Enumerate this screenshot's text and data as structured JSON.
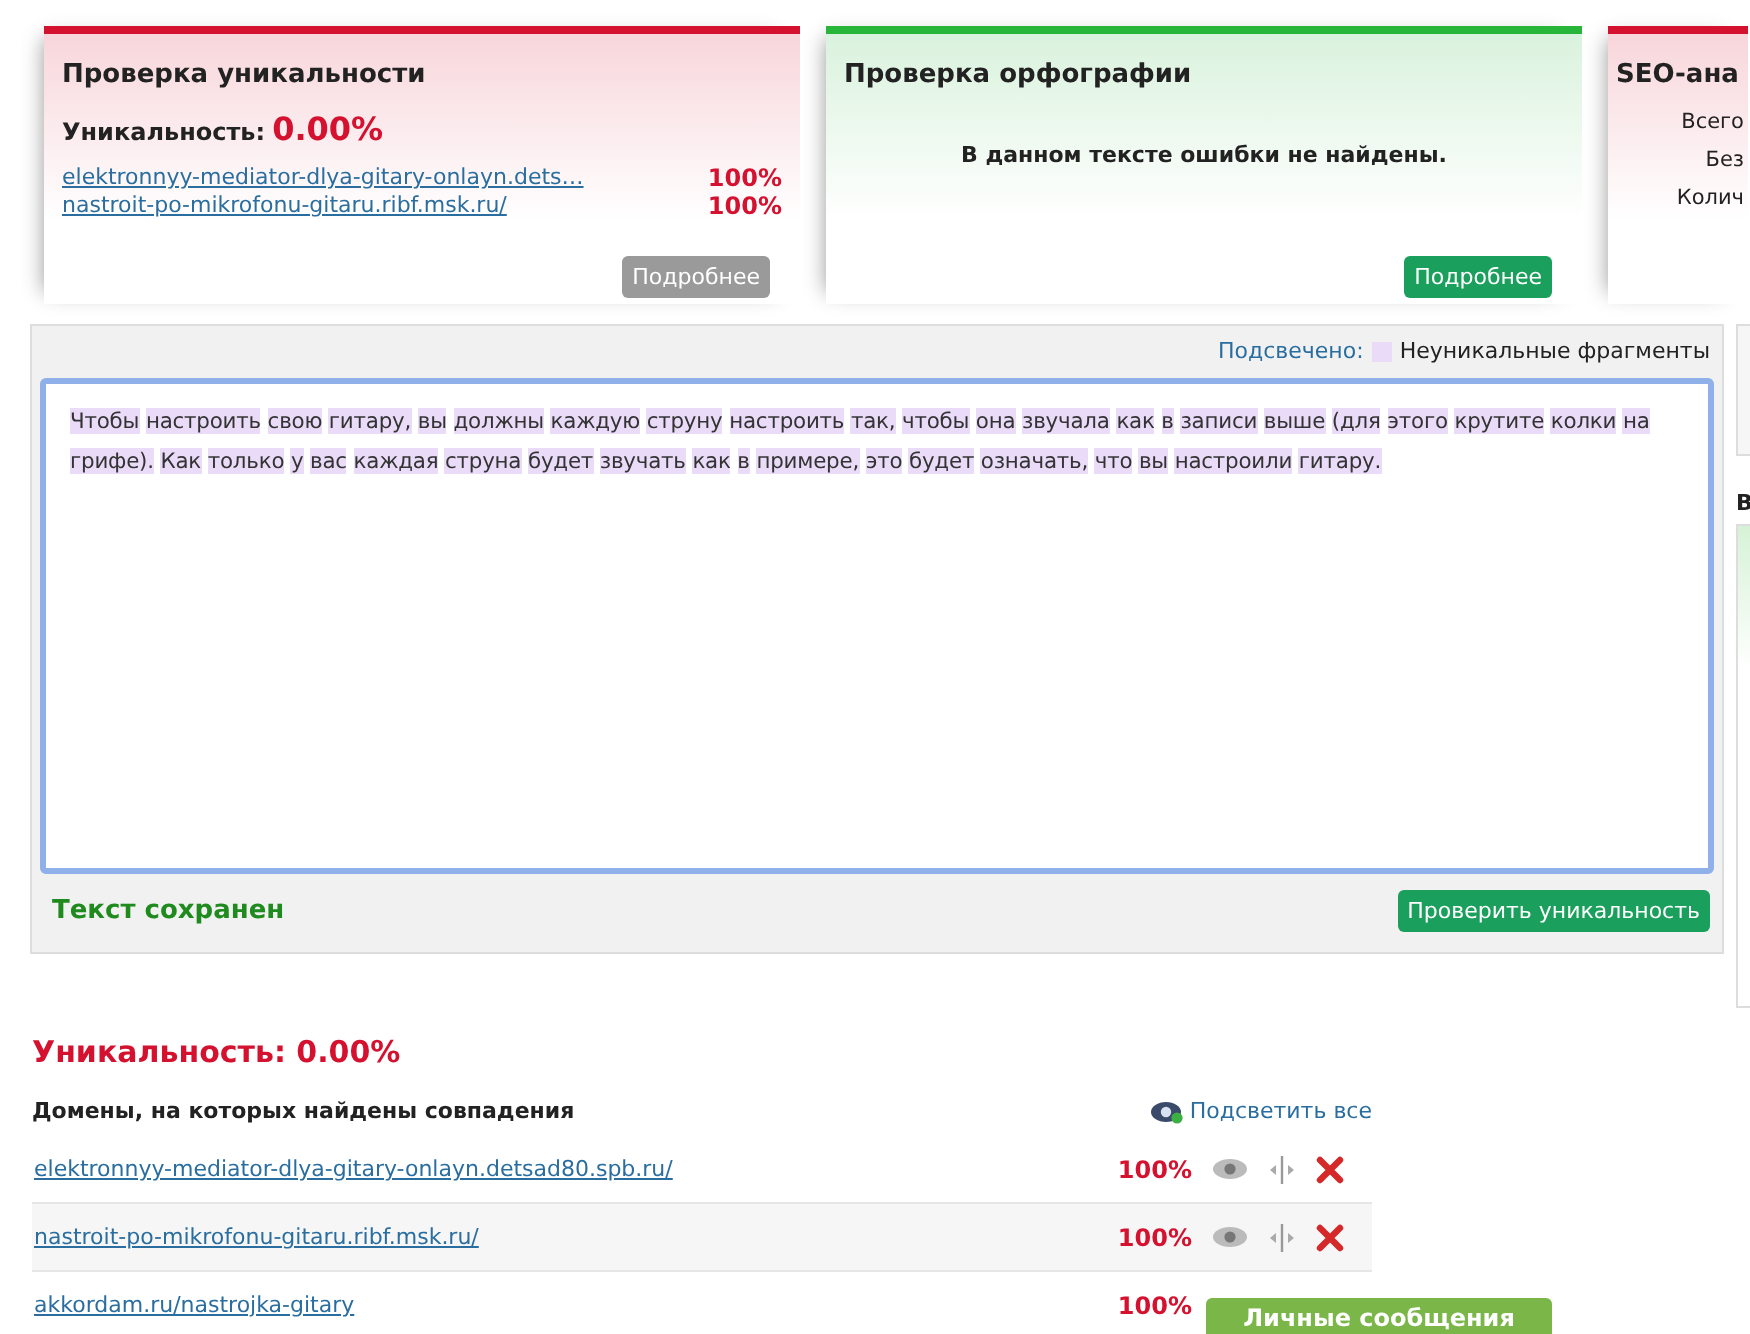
{
  "cards": [
    {
      "kind": "uniqueness",
      "color": "#d4112e",
      "title": "Проверка уникальности",
      "label": "Уникальность:",
      "value": "0.00%",
      "links": [
        {
          "url": "elektronnyy-mediator-dlya-gitary-onlayn.dets…",
          "percent": "100%"
        },
        {
          "url": "nastroit-po-mikrofonu-gitaru.ribf.msk.ru/",
          "percent": "100%"
        }
      ],
      "button": "Подробнее",
      "button_disabled": true
    },
    {
      "kind": "spelling",
      "color": "#27b53a",
      "title": "Проверка орфографии",
      "message": "В данном тексте ошибки не найдены.",
      "button": "Подробнее",
      "button_disabled": false
    },
    {
      "kind": "seo",
      "color": "#d4112e",
      "title": "SEO-ана",
      "lines": [
        "Всего",
        "Без",
        "Колич"
      ]
    }
  ],
  "editor": {
    "legend_label": "Подсвечено:",
    "legend_text": "Неуникальные фрагменты",
    "text": "Чтобы настроить свою гитару, вы должны каждую струну настроить так, чтобы она звучала как в записи выше (для этого крутите колки на грифе). Как только у вас каждая струна будет звучать как в примере, это будет означать, что вы настроили гитару.",
    "highlighted": true,
    "status": "Текст сохранен",
    "button": "Проверить уникальность"
  },
  "result": {
    "title": "Уникальность: 0.00%",
    "domains_header": "Домены, на которых найдены совпадения",
    "highlight_all": "Подсветить все",
    "rows": [
      {
        "url": "elektronnyy-mediator-dlya-gitary-onlayn.detsad80.spb.ru/",
        "percent": "100%",
        "actions": true
      },
      {
        "url": "nastroit-po-mikrofonu-gitaru.ribf.msk.ru/",
        "percent": "100%",
        "actions": true
      },
      {
        "url": "akkordam.ru/nastrojka-gitary",
        "percent": "100%",
        "actions": false
      }
    ]
  },
  "sidebar": {
    "letter": "В"
  },
  "messages_button": "Личные сообщения"
}
